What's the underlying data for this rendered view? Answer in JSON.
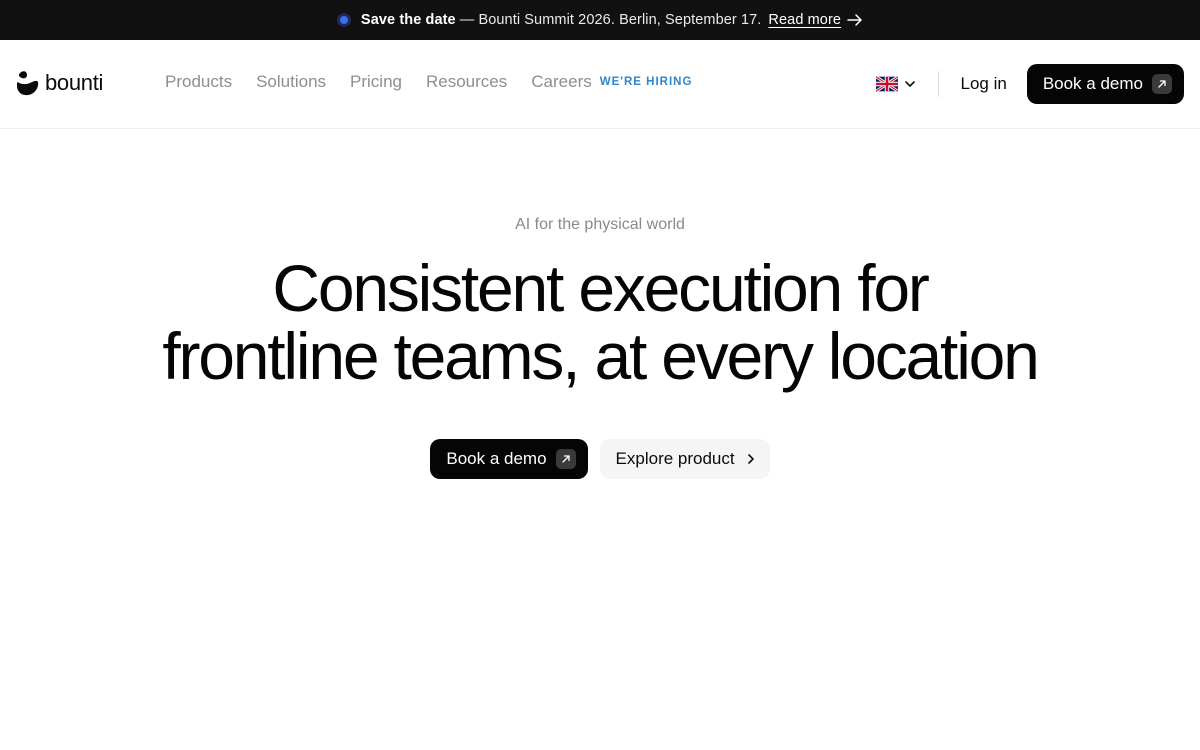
{
  "announcement": {
    "highlight": "Save the date",
    "text": "— Bounti Summit 2026. Berlin, September 17.",
    "link_label": "Read more",
    "dot_color": "#3d6ef0",
    "icons": [
      "status-dot-icon",
      "arrow-right-icon"
    ]
  },
  "brand": {
    "name": "bounti",
    "logo_icon": "bounti-logo-icon"
  },
  "nav": {
    "items": [
      "Products",
      "Solutions",
      "Pricing",
      "Resources",
      "Careers"
    ],
    "hiring_badge": "WE'RE HIRING",
    "hiring_color": "#2f86c9",
    "language_icon": "uk-flag-icon",
    "login": "Log in",
    "cta": "Book a demo"
  },
  "hero": {
    "eyebrow": "AI for the physical world",
    "headline_line1": "Consistent execution for",
    "headline_line2": "frontline teams, at every location",
    "primary_cta": "Book a demo",
    "secondary_cta": "Explore product"
  }
}
